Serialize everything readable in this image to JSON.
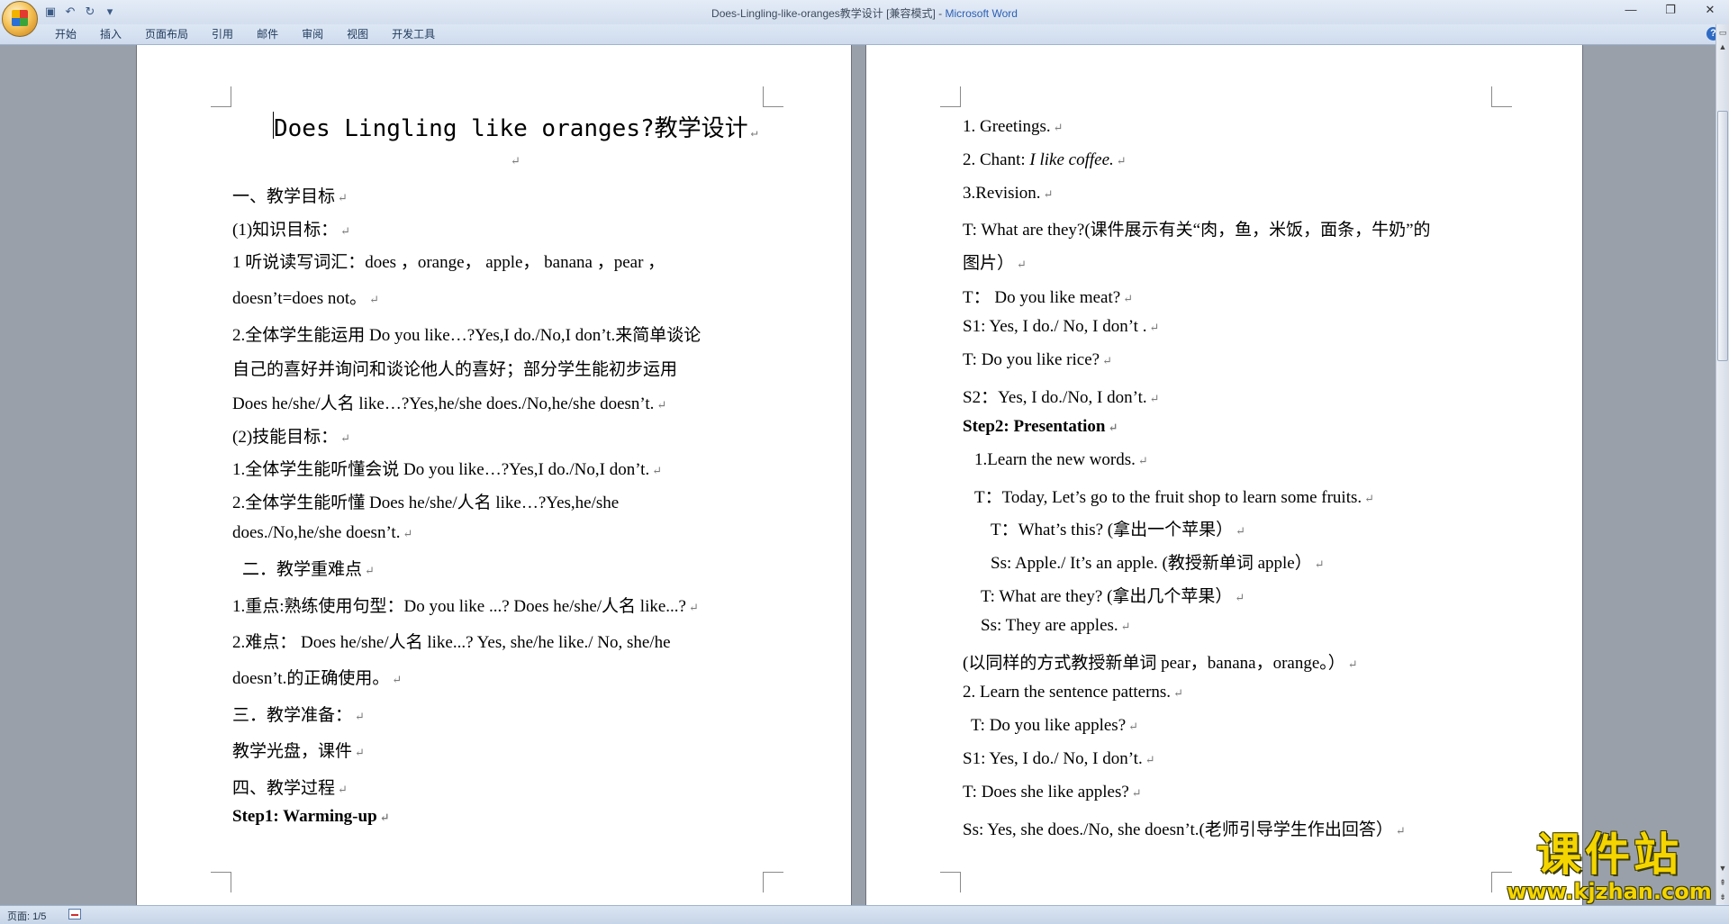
{
  "window": {
    "title": "Does-Lingling-like-oranges教学设计 [兼容模式] - ",
    "app_name": "Microsoft Word"
  },
  "qat": {
    "save_icon": "save-icon",
    "undo_icon": "undo-icon",
    "redo_icon": "redo-icon",
    "customize_icon": "customize-qat-icon"
  },
  "ribbon": {
    "tabs": [
      "开始",
      "插入",
      "页面布局",
      "引用",
      "邮件",
      "审阅",
      "视图",
      "开发工具"
    ]
  },
  "document": {
    "title": "Does Lingling like oranges?教学设计",
    "page1": [
      "一、教学目标",
      "(1)知识目标：",
      "1  听说读写词汇：does  ，orange，  apple，  banana  ，pear  ，",
      "doesn’t=does not。",
      "2.全体学生能运用 Do you like…?Yes,I do./No,I don’t.来简单谈论",
      "自己的喜好并询问和谈论他人的喜好；部分学生能初步运用",
      "Does he/she/人名  like…?Yes,he/she does./No,he/she doesn’t.",
      "(2)技能目标：",
      "1.全体学生能听懂会说 Do you like…?Yes,I do./No,I don’t.",
      "2.全体学生能听懂 Does he/she/人名  like…?Yes,he/she",
      "does./No,he/she doesn’t.",
      "二．教学重难点",
      "1.重点:熟练使用句型：Do you like ...? Does he/she/人名  like...?",
      "2.难点：  Does he/she/人名  like...?  Yes,  she/he  like./  No,  she/he",
      "doesn’t.的正确使用。",
      "三．教学准备：",
      "教学光盘，课件",
      "四、教学过程",
      "Step1: Warming-up"
    ],
    "page2": [
      "1. Greetings.",
      "2. Chant: ",
      "I like coffee.",
      "3.Revision.",
      "T: What are they?(课件展示有关“肉，鱼，米饭，面条，牛奶”的",
      "图片）",
      "T：  Do you like meat?",
      "S1: Yes, I do./ No, I don’t .",
      "T:    Do you like rice?",
      "S2：Yes, I do./No, I don’t.",
      "Step2: Presentation",
      "1.Learn the new words.",
      "T：Today, Let’s go to the fruit shop to learn some fruits.",
      "T：What’s this? (拿出一个苹果）",
      "Ss: Apple./ It’s an apple. (教授新单词 apple）",
      "T: What are they? (拿出几个苹果）",
      "Ss: They are apples.",
      "(以同样的方式教授新单词 pear，banana，orange。）",
      "2. Learn the sentence patterns.",
      "T: Do you like apples?",
      "S1: Yes, I do./ No, I don’t.",
      "T: Does she like apples?",
      "Ss: Yes, she does./No, she doesn’t.(老师引导学生作出回答）"
    ]
  },
  "statusbar": {
    "page": "页面: 1/5"
  },
  "watermark": {
    "title": "课件站",
    "url": "www.kjzhan.com"
  }
}
